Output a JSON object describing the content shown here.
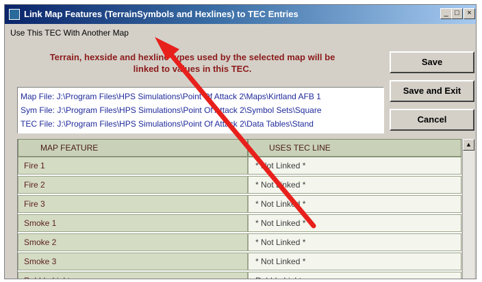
{
  "window": {
    "title": "Link Map Features (TerrainSymbols and Hexlines) to TEC Entries",
    "min_glyph": "_",
    "max_glyph": "□",
    "close_glyph": "×"
  },
  "menu": {
    "item": "Use This TEC With Another Map"
  },
  "notice": {
    "line1": "Terrain, hexside and hexline types used by the selected map will be",
    "line2": "linked to values in this TEC."
  },
  "buttons": {
    "save": "Save",
    "save_exit": "Save and Exit",
    "cancel": "Cancel"
  },
  "files": {
    "map": "Map File: J:\\Program Files\\HPS Simulations\\Point Of Attack 2\\Maps\\Kirtland AFB 1",
    "sym": "Sym File: J:\\Program Files\\HPS Simulations\\Point Of Attack 2\\Symbol Sets\\Square",
    "tec": "TEC File: J:\\Program Files\\HPS Simulations\\Point Of Attack 2\\Data Tables\\Stand"
  },
  "table": {
    "headers": {
      "feature": "MAP FEATURE",
      "tec_line": "USES TEC LINE"
    },
    "rows": [
      {
        "feature": "Fire 1",
        "tec": "* Not Linked *"
      },
      {
        "feature": "Fire 2",
        "tec": "* Not Linked *"
      },
      {
        "feature": "Fire 3",
        "tec": "* Not Linked *"
      },
      {
        "feature": "Smoke 1",
        "tec": "* Not Linked *"
      },
      {
        "feature": "Smoke 2",
        "tec": "* Not Linked *"
      },
      {
        "feature": "Smoke 3",
        "tec": "* Not Linked *"
      },
      {
        "feature": "Rubble Light",
        "tec": "Rubble Light"
      }
    ]
  },
  "scrollbar": {
    "up_glyph": "▲"
  },
  "colors": {
    "annotation_arrow": "#e8201c",
    "title_bar": "#0a246a"
  }
}
